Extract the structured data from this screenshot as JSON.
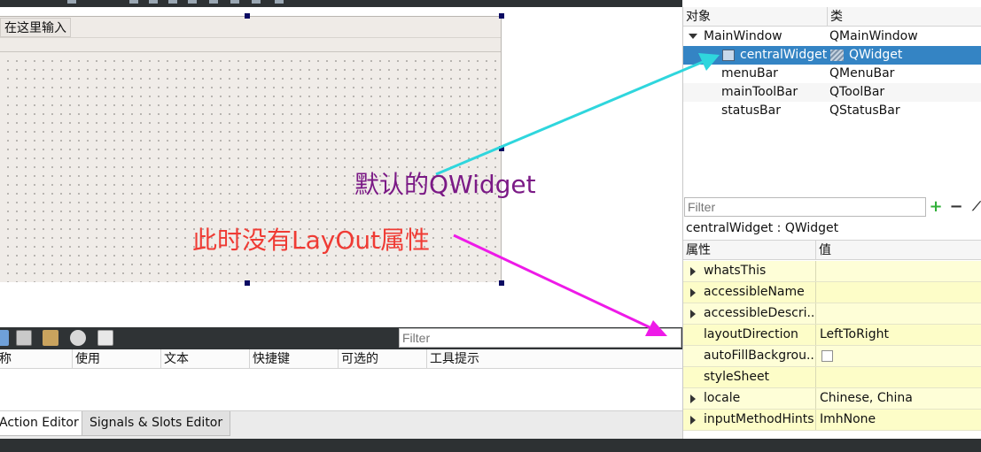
{
  "form": {
    "menu_placeholder": "在这里输入"
  },
  "annotations": {
    "default_widget": "默认的QWidget",
    "no_layout": "此时没有LayOut属性"
  },
  "action_editor": {
    "filter_placeholder": "Filter",
    "columns": [
      "称",
      "使用",
      "文本",
      "快捷键",
      "可选的",
      "工具提示"
    ],
    "tabs": [
      "Action Editor",
      "Signals & Slots Editor"
    ]
  },
  "object_inspector": {
    "headers": [
      "对象",
      "类"
    ],
    "rows": [
      {
        "name": "MainWindow",
        "class": "QMainWindow"
      },
      {
        "name": "centralWidget",
        "class": "QWidget"
      },
      {
        "name": "menuBar",
        "class": "QMenuBar"
      },
      {
        "name": "mainToolBar",
        "class": "QToolBar"
      },
      {
        "name": "statusBar",
        "class": "QStatusBar"
      }
    ]
  },
  "property_editor": {
    "filter_placeholder": "Filter",
    "add_symbol": "+",
    "remove_symbol": "−",
    "object_label": "centralWidget : QWidget",
    "headers": [
      "属性",
      "值"
    ],
    "properties": [
      {
        "name": "whatsThis",
        "value": ""
      },
      {
        "name": "accessibleName",
        "value": ""
      },
      {
        "name": "accessibleDescri...",
        "value": ""
      },
      {
        "name": "layoutDirection",
        "value": "LeftToRight"
      },
      {
        "name": "autoFillBackgrou...",
        "value": ""
      },
      {
        "name": "styleSheet",
        "value": ""
      },
      {
        "name": "locale",
        "value": "Chinese, China"
      },
      {
        "name": "inputMethodHints",
        "value": "ImhNone"
      }
    ]
  },
  "colors": {
    "selection": "#3484c4",
    "annotation_purple": "#7b1a86",
    "annotation_red": "#ef3b34",
    "arrow_cyan": "#2fd6dd",
    "arrow_magenta": "#ee1ae8",
    "property_yellow": "#fefed7"
  }
}
